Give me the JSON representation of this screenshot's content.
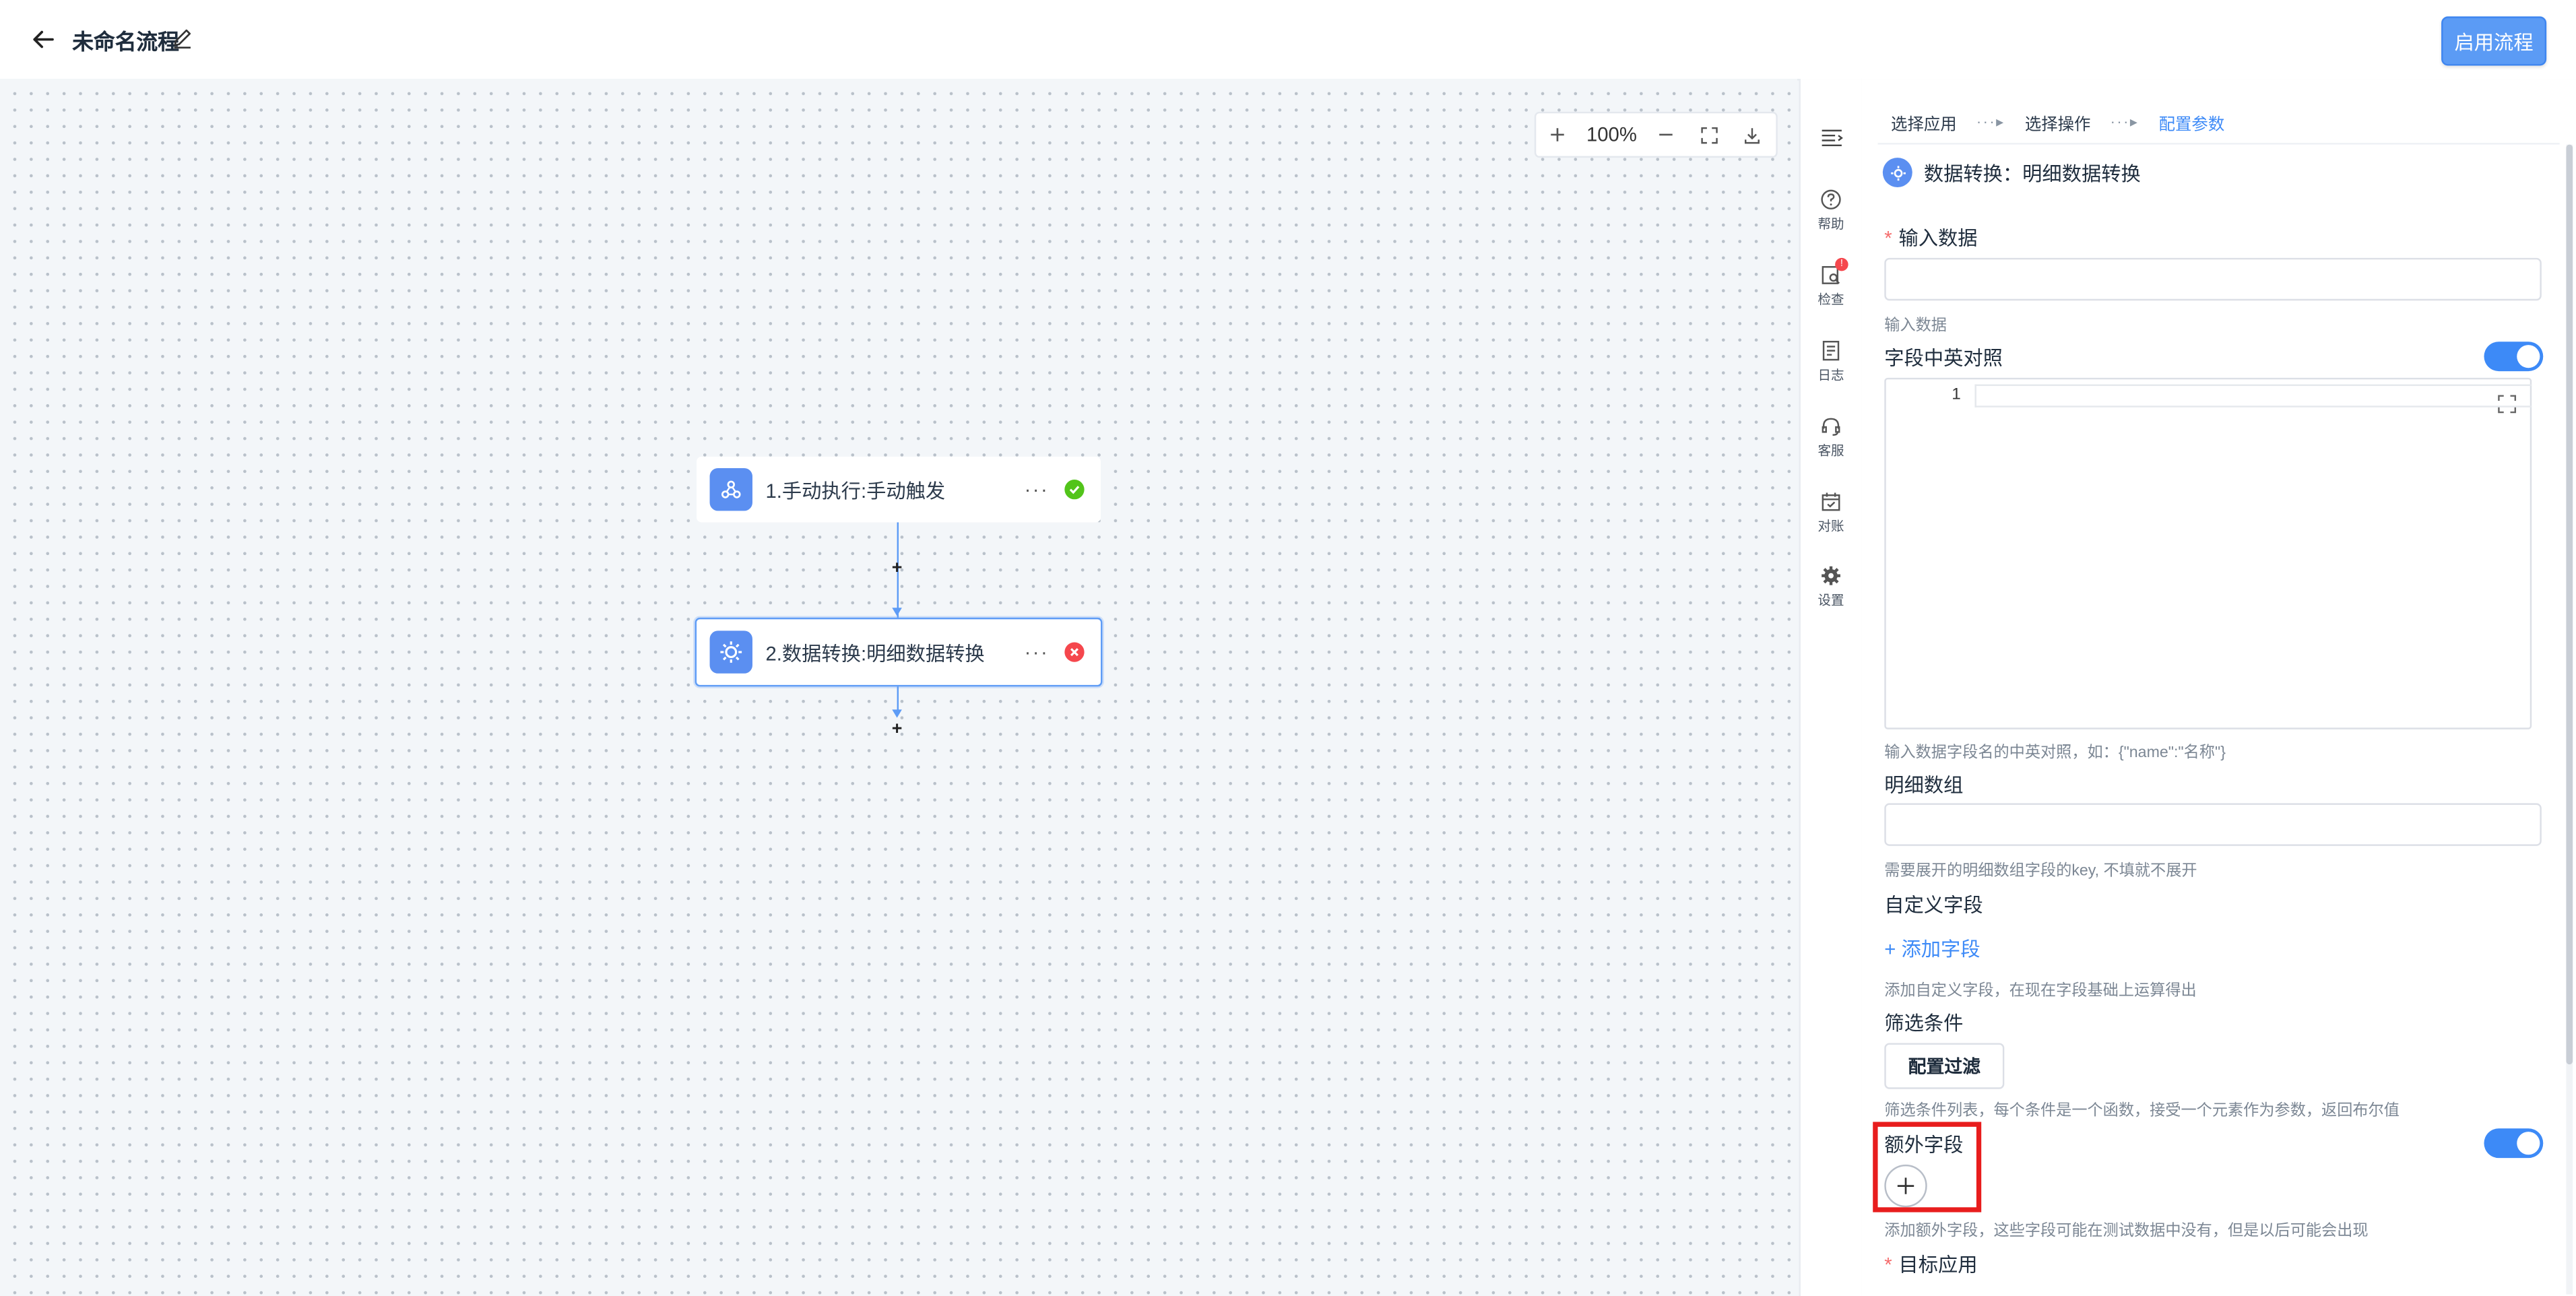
{
  "header": {
    "title": "未命名流程",
    "enable_button": "启用流程"
  },
  "canvas": {
    "zoom": "100%",
    "nodes": [
      {
        "label": "1.手动执行:手动触发",
        "status": "success"
      },
      {
        "label": "2.数据转换:明细数据转换",
        "status": "error"
      }
    ],
    "more_label": "···"
  },
  "side_toolbar": {
    "items": [
      {
        "label": "帮助",
        "icon": "help-icon"
      },
      {
        "label": "检查",
        "icon": "check-icon",
        "badge": "!"
      },
      {
        "label": "日志",
        "icon": "log-icon"
      },
      {
        "label": "客服",
        "icon": "support-icon"
      },
      {
        "label": "对账",
        "icon": "reconcile-icon"
      },
      {
        "label": "设置",
        "icon": "settings-icon"
      }
    ]
  },
  "panel": {
    "steps": [
      "选择应用",
      "选择操作",
      "配置参数"
    ],
    "step_separator": "···▸",
    "operation_title": "数据转换：明细数据转换",
    "input_data": {
      "label": "输入数据",
      "hint": "输入数据",
      "value": ""
    },
    "field_mapping": {
      "label": "字段中英对照",
      "line_number": "1",
      "hint": "输入数据字段名的中英对照，如：{\"name\":\"名称\"}"
    },
    "detail_array": {
      "label": "明细数组",
      "hint": "需要展开的明细数组字段的key, 不填就不展开",
      "value": ""
    },
    "custom_fields": {
      "label": "自定义字段",
      "add_link": "+ 添加字段",
      "hint": "添加自定义字段，在现在字段基础上运算得出"
    },
    "filter": {
      "label": "筛选条件",
      "button": "配置过滤",
      "hint": "筛选条件列表，每个条件是一个函数，接受一个元素作为参数，返回布尔值"
    },
    "extra_fields": {
      "label": "额外字段",
      "hint": "添加额外字段，这些字段可能在测试数据中没有，但是以后可能会出现"
    },
    "target_app": {
      "label": "目标应用"
    }
  },
  "colors": {
    "accent": "#3d8af7",
    "success": "#52c41a",
    "error": "#f5474d",
    "highlight": "#e81d1d"
  }
}
